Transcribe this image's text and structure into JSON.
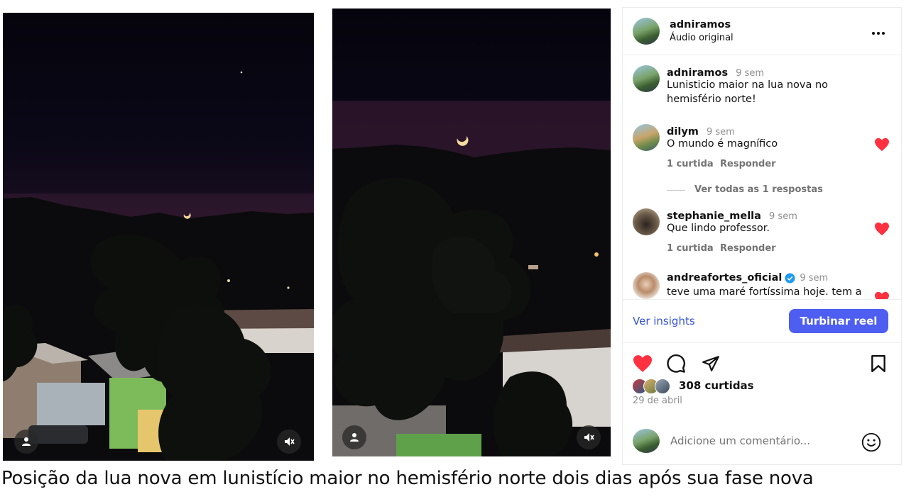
{
  "post": {
    "username": "adniramos",
    "audio": "Áudio original",
    "more_icon": "more-horizontal-icon"
  },
  "comments": [
    {
      "username": "adniramos",
      "time": "9 sem",
      "text_line1": "Lunisticio maior na lua nova no",
      "text_line2": "hemisfério norte!"
    },
    {
      "username": "dilym",
      "time": "9 sem",
      "text": "O mundo é magnífico",
      "likes": "1 curtida",
      "reply": "Responder",
      "view_replies": "Ver todas as 1 respostas"
    },
    {
      "username": "stephanie_mella",
      "time": "9 sem",
      "text": "Que lindo professor.",
      "likes": "1 curtida",
      "reply": "Responder"
    },
    {
      "username": "andreafortes_oficial",
      "time": "9 sem",
      "text": "teve uma maré fortíssima hoje. tem a"
    }
  ],
  "actions": {
    "insights": "Ver insights",
    "boost": "Turbinar reel",
    "like_count": "308 curtidas",
    "date": "29 de abril",
    "comment_placeholder": "Adicione um comentário..."
  },
  "caption": "Posição da lua nova em lunistício maior no hemisfério norte dois dias após sua fase nova",
  "colors": {
    "like_red": "#ff3040",
    "primary_blue": "#4e5ef0",
    "link_blue": "#3653d6",
    "verified_blue": "#1d9bf0"
  }
}
